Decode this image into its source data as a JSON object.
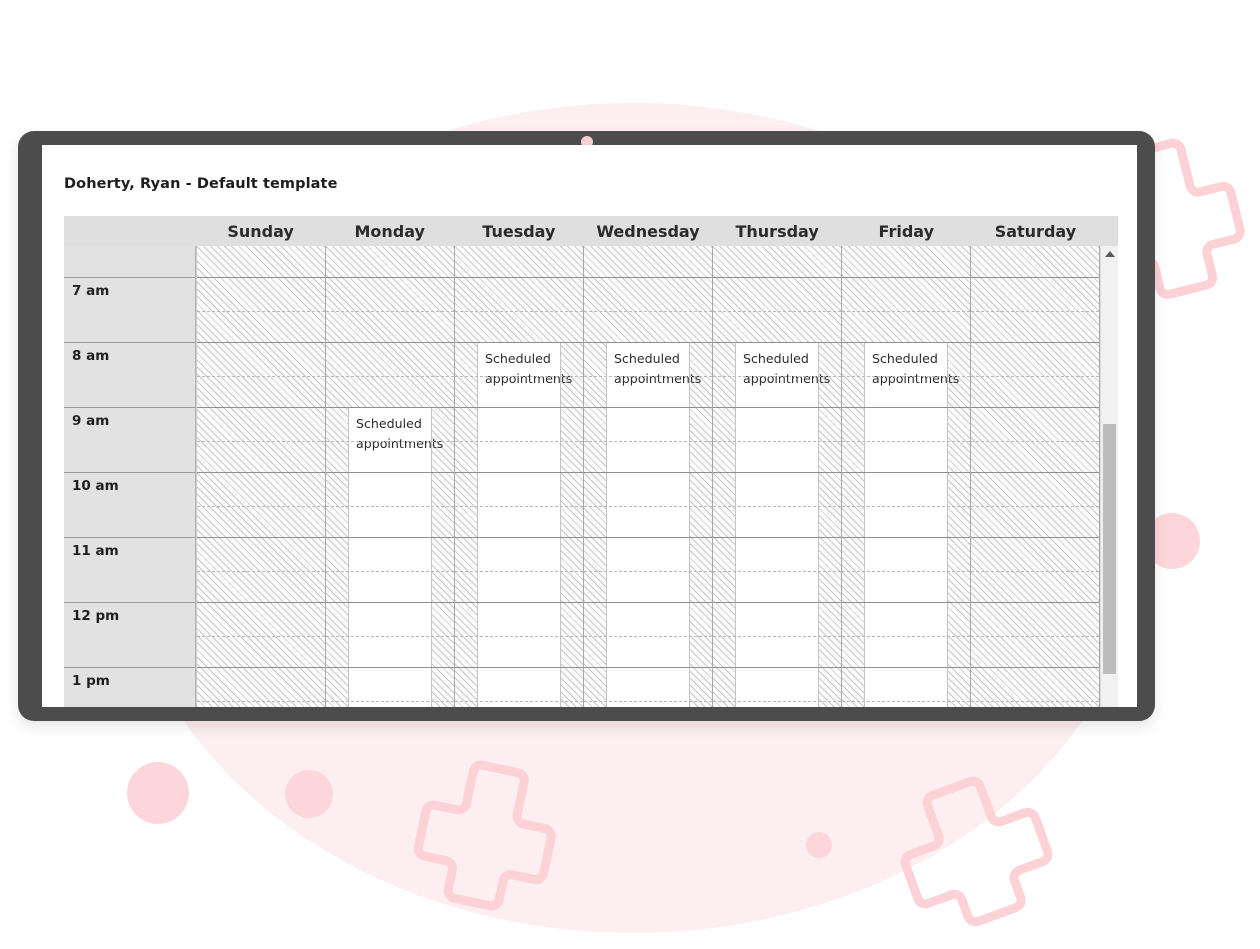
{
  "app": {
    "title": "Doherty, Ryan - Default template",
    "camera_icon": "camera-dot"
  },
  "calendar": {
    "corner_label": "",
    "day_headers": [
      "Sunday",
      "Monday",
      "Tuesday",
      "Wednesday",
      "Thursday",
      "Friday",
      "Saturday"
    ],
    "time_labels": [
      "7 am",
      "8 am",
      "9 am",
      "10 am",
      "11 am",
      "12 pm",
      "1 pm"
    ],
    "appointment_label": "Scheduled appointments",
    "day_blocks": [
      {
        "day": "Sunday",
        "has_block": false,
        "label": "",
        "start_hour_index": null,
        "span_rows": 0
      },
      {
        "day": "Monday",
        "has_block": true,
        "label": "Scheduled appointments",
        "start_hour_index": 2,
        "span_rows": 5
      },
      {
        "day": "Tuesday",
        "has_block": true,
        "label": "Scheduled appointments",
        "start_hour_index": 1,
        "span_rows": 6
      },
      {
        "day": "Wednesday",
        "has_block": true,
        "label": "Scheduled appointments",
        "start_hour_index": 1,
        "span_rows": 6
      },
      {
        "day": "Thursday",
        "has_block": true,
        "label": "Scheduled appointments",
        "start_hour_index": 1,
        "span_rows": 6
      },
      {
        "day": "Friday",
        "has_block": true,
        "label": "Scheduled appointments",
        "start_hour_index": 1,
        "span_rows": 6
      },
      {
        "day": "Saturday",
        "has_block": false,
        "label": "",
        "start_hour_index": null,
        "span_rows": 0
      }
    ],
    "scrollbar": {
      "up_arrow_icon": "triangle-up-icon",
      "thumb_position_pct": 39,
      "thumb_size_pct": 54
    }
  },
  "theme": {
    "accent_pink": "#fcd6da",
    "blob_pink": "#fdeef1",
    "bezel_gray": "#4c4c4c",
    "header_gray": "#dfdfdf",
    "gutter_gray": "#e2e2e2",
    "text_dark": "#1d1d1d"
  },
  "decorations": {
    "shapes": [
      "pink-blob-circle",
      "pink-dot-right",
      "pink-dot-lower-left",
      "pink-dot-lower-left-small",
      "pink-dot-tiny",
      "pink-cross-outline-top-right",
      "pink-cross-outline-bottom-left",
      "pink-cross-outline-bottom-right"
    ]
  }
}
